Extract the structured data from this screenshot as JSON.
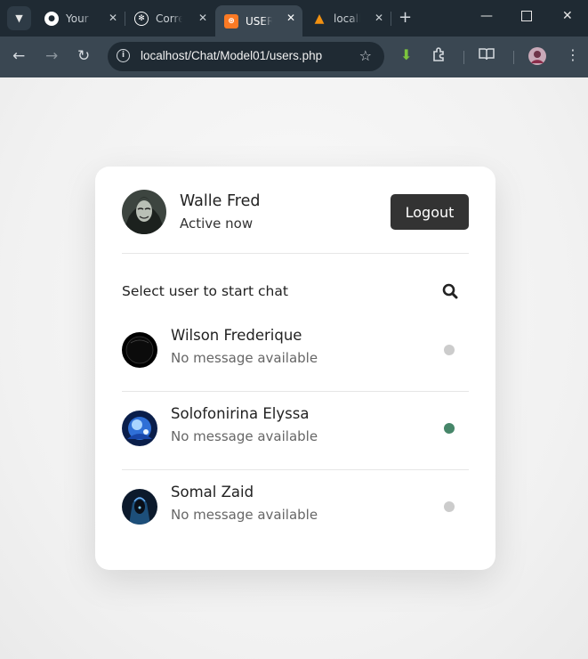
{
  "browser": {
    "tabs": [
      {
        "label": "Your g",
        "icon": "github-icon"
      },
      {
        "label": "Corre",
        "icon": "chatgpt-icon"
      },
      {
        "label": "USER",
        "icon": "xampp-icon"
      },
      {
        "label": "locall",
        "icon": "phpmyadmin-icon"
      }
    ],
    "url": "localhost/Chat/Model01/users.php"
  },
  "current_user": {
    "name": "Walle Fred",
    "status": "Active now"
  },
  "logout_label": "Logout",
  "search": {
    "label": "Select user to start chat",
    "icon": "search-icon"
  },
  "users": [
    {
      "name": "Wilson Frederique",
      "message": "No message available",
      "status": "offline"
    },
    {
      "name": "Solofonirina Elyssa",
      "message": "No message available",
      "status": "online"
    },
    {
      "name": "Somal Zaid",
      "message": "No message available",
      "status": "offline"
    }
  ],
  "colors": {
    "online": "#468669",
    "offline": "#cccccc",
    "logout_bg": "#333333"
  }
}
